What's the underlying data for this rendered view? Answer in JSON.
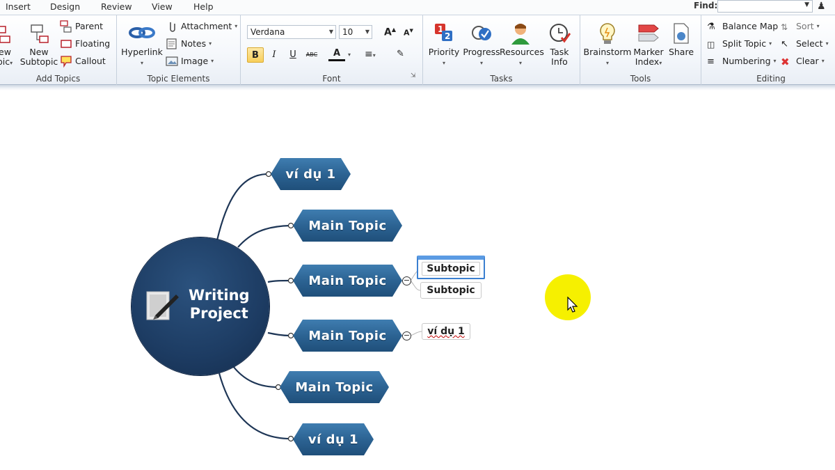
{
  "menu": {
    "tabs": [
      "Insert",
      "Design",
      "Review",
      "View",
      "Help"
    ],
    "find_label": "Find:",
    "find_value": ""
  },
  "ribbon": {
    "add_topics": {
      "label": "Add Topics",
      "new_topic_line1": "ew",
      "new_topic_line2": "pic",
      "new_subtopic_line1": "New",
      "new_subtopic_line2": "Subtopic",
      "parent": "Parent",
      "floating": "Floating",
      "callout": "Callout"
    },
    "topic_elements": {
      "label": "Topic Elements",
      "hyperlink": "Hyperlink",
      "attachment": "Attachment",
      "notes": "Notes",
      "image": "Image"
    },
    "font": {
      "label": "Font",
      "family": "Verdana",
      "size": "10",
      "bold": "B",
      "italic": "I",
      "underline": "U",
      "strike": "ABC",
      "color": "A"
    },
    "tasks": {
      "label": "Tasks",
      "priority": "Priority",
      "progress": "Progress",
      "resources": "Resources",
      "task_info_line1": "Task",
      "task_info_line2": "Info"
    },
    "tools": {
      "label": "Tools",
      "brainstorm": "Brainstorm",
      "marker_index_line1": "Marker",
      "marker_index_line2": "Index",
      "share": "Share"
    },
    "editing": {
      "label": "Editing",
      "balance_map": "Balance Map",
      "sort": "Sort",
      "split_topic": "Split Topic",
      "select": "Select",
      "numbering": "Numbering",
      "clear": "Clear"
    }
  },
  "map": {
    "central_line1": "Writing",
    "central_line2": "Project",
    "topics": [
      {
        "label": "ví dụ 1"
      },
      {
        "label": "Main Topic"
      },
      {
        "label": "Main Topic"
      },
      {
        "label": "Main Topic"
      },
      {
        "label": "Main Topic"
      },
      {
        "label": "ví dụ 1"
      }
    ],
    "subtopics": [
      {
        "label": "Subtopic"
      },
      {
        "label": "Subtopic"
      },
      {
        "label": "ví dụ 1"
      }
    ],
    "collapse_symbol": "−"
  },
  "colors": {
    "topic_fill": "#2c6393",
    "central_fill": "#1d3c63",
    "cursor_highlight": "#f6f000",
    "selected_border": "#3a7fd0"
  }
}
